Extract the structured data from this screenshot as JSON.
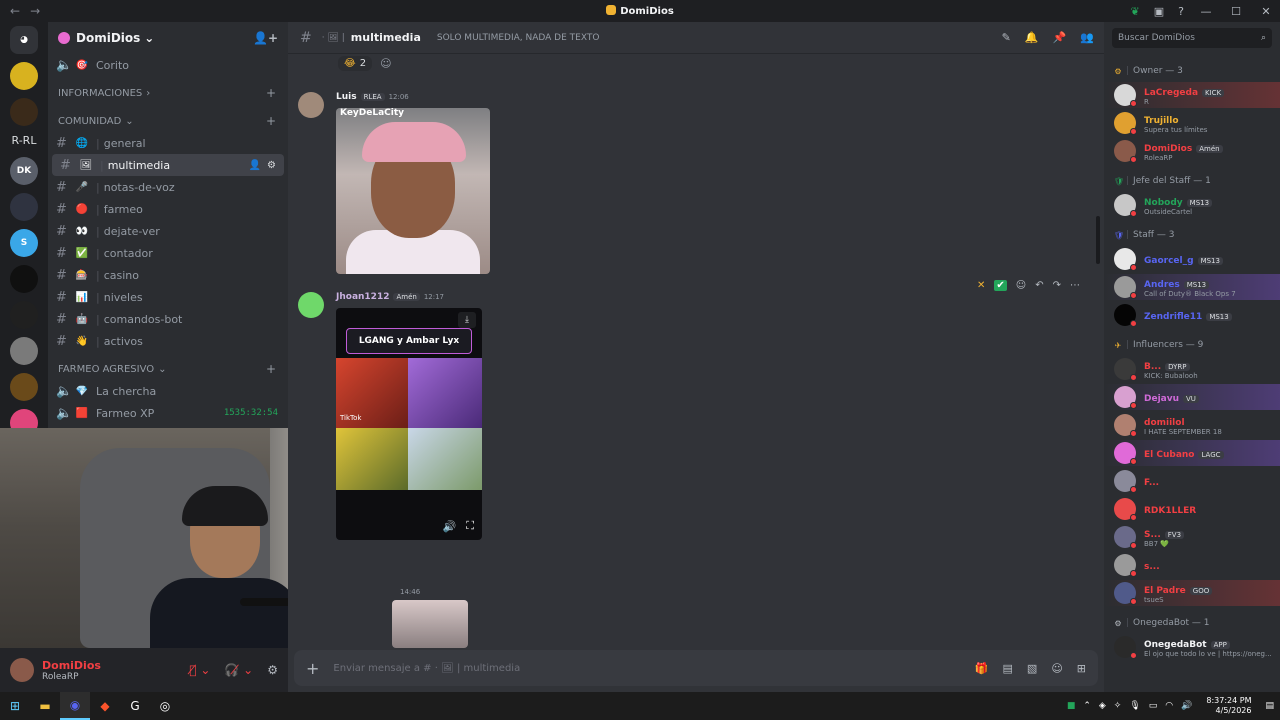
{
  "window": {
    "title": "DomiDios",
    "nav_back": "←",
    "nav_forward": "→",
    "minimize": "—",
    "maximize": "☐",
    "close": "✕"
  },
  "servers": [
    {
      "name": "home",
      "label": "",
      "color": "#313338"
    },
    {
      "name": "server-yellow",
      "label": "",
      "color": "#d8b21f"
    },
    {
      "name": "server-dark",
      "label": "",
      "color": "#3a2a1a"
    },
    {
      "name": "server-rrl",
      "label": "R-RL",
      "color": "#1e1f22"
    },
    {
      "name": "server-dk",
      "label": "DK",
      "color": "#5a5f6a"
    },
    {
      "name": "server-robot",
      "label": "",
      "color": "#2f3340"
    },
    {
      "name": "server-s",
      "label": "S",
      "color": "#3aa7e8"
    },
    {
      "name": "server-x",
      "label": "",
      "color": "#101010"
    },
    {
      "name": "server-dark2",
      "label": "",
      "color": "#202020"
    },
    {
      "name": "server-grey",
      "label": "",
      "color": "#7a7a7a"
    },
    {
      "name": "server-gold",
      "label": "",
      "color": "#6a4a1a"
    },
    {
      "name": "server-pink",
      "label": "",
      "color": "#e0457b"
    }
  ],
  "guild": {
    "name": "DomiDios",
    "chevron": "⌄",
    "invite_icon": "👤+"
  },
  "channels": {
    "top_item": {
      "emoji": "🎯",
      "label": "Corito"
    },
    "categories": [
      {
        "key": "info",
        "label": "INFORMACIONES"
      },
      {
        "key": "comunidad",
        "label": "COMUNIDAD"
      },
      {
        "key": "farmeo",
        "label": "FARMEO AGRESIVO"
      }
    ],
    "comunidad": [
      {
        "emoji": "🌐",
        "label": "general",
        "active": false
      },
      {
        "emoji": "🖼",
        "label": "multimedia",
        "active": true
      },
      {
        "emoji": "🎤",
        "label": "notas-de-voz",
        "active": false
      },
      {
        "emoji": "🔴",
        "label": "farmeo",
        "active": false
      },
      {
        "emoji": "👀",
        "label": "dejate-ver",
        "active": false
      },
      {
        "emoji": "✅",
        "label": "contador",
        "active": false
      },
      {
        "emoji": "🎰",
        "label": "casino",
        "active": false
      },
      {
        "emoji": "📊",
        "label": "niveles",
        "active": false
      },
      {
        "emoji": "🤖",
        "label": "comandos-bot",
        "active": false
      },
      {
        "emoji": "👋",
        "label": "activos",
        "active": false
      }
    ],
    "voice": [
      {
        "emoji": "💎",
        "label": "La chercha",
        "timer": ""
      },
      {
        "emoji": "🟥",
        "label": "Farmeo XP",
        "timer": "1535:32:54"
      }
    ]
  },
  "user": {
    "name": "DomiDios",
    "status": "RoleaRP"
  },
  "header": {
    "channel": "multimedia",
    "topic": "SOLO MULTIMEDIA, NADA DE TEXTO"
  },
  "reaction": {
    "emoji": "😂",
    "count": "2"
  },
  "messages": [
    {
      "author": "Luis",
      "tag": "RLEA",
      "time": "12:06",
      "color": "#f2f3f5",
      "avatar": "#a08a7a",
      "caption": "KeyDeLaCity"
    },
    {
      "author": "Jhoan1212",
      "tag": "Amén",
      "time": "12:17",
      "color": "#c9b1e0",
      "avatar": "#6fd86a",
      "banner": "LGANG y Ambar Lyx",
      "watermark": "TikTok"
    },
    {
      "time": "14:46"
    }
  ],
  "composer": {
    "placeholder": "Enviar mensaje a # · 🖼 | multimedia"
  },
  "members": {
    "search_placeholder": "Buscar DomiDios",
    "groups": [
      {
        "title": "Owner — 3",
        "icon": "⚙",
        "icon_color": "#f0b232",
        "items": [
          {
            "name": "LaCregeda",
            "sub": "R",
            "tag": "KICK",
            "color": "#f23f43",
            "avatar": "#d8d8d8",
            "hl": "hl2"
          },
          {
            "name": "Trujillo",
            "sub": "Supera tus límites",
            "tag": "",
            "color": "#f0b232",
            "avatar": "#e0a030",
            "hl": ""
          },
          {
            "name": "DomiDios",
            "sub": "RoleaRP",
            "tag": "Amén",
            "color": "#f23f43",
            "avatar": "#8a5a4a",
            "hl": ""
          }
        ]
      },
      {
        "title": "Jefe del Staff — 1",
        "icon": "🛡",
        "icon_color": "#23a55a",
        "items": [
          {
            "name": "Nobody",
            "sub": "OutsideCartel",
            "tag": "MS13",
            "color": "#23a55a",
            "avatar": "#c7c7c7",
            "hl": ""
          }
        ]
      },
      {
        "title": "Staff — 3",
        "icon": "🛡",
        "icon_color": "#5865f2",
        "items": [
          {
            "name": "Gaorcel_g",
            "sub": "",
            "tag": "MS13",
            "color": "#5865f2",
            "avatar": "#e8e8e8",
            "hl": ""
          },
          {
            "name": "Andres",
            "sub": "Call of Duty® Black Ops 7",
            "tag": "MS13",
            "color": "#5865f2",
            "avatar": "#9a9a9a",
            "hl": "hl"
          },
          {
            "name": "Zendrifle11",
            "sub": "",
            "tag": "MS13",
            "color": "#5865f2",
            "avatar": "#050505",
            "hl": ""
          }
        ]
      },
      {
        "title": "Influencers — 9",
        "icon": "✈",
        "icon_color": "#f0b232",
        "items": [
          {
            "name": "B...",
            "sub": "KICK: Bubalooh",
            "tag": "DYRP",
            "color": "#f23f43",
            "avatar": "#3a3a3a",
            "hl": ""
          },
          {
            "name": "Dejavu",
            "sub": "",
            "tag": "VU",
            "color": "#d06ad8",
            "avatar": "#d8a0d0",
            "hl": "hl"
          },
          {
            "name": "domiilol",
            "sub": "I HATE SEPTEMBER 18",
            "tag": "",
            "color": "#f23f43",
            "avatar": "#b08070",
            "hl": ""
          },
          {
            "name": "El Cubano",
            "sub": "",
            "tag": "LAGC",
            "color": "#f23f43",
            "avatar": "#e06ad8",
            "hl": "hl"
          },
          {
            "name": "F...",
            "sub": "",
            "tag": "",
            "color": "#f23f43",
            "avatar": "#8a8a9a",
            "hl": ""
          },
          {
            "name": "RDK1LLER",
            "sub": "",
            "tag": "",
            "color": "#f23f43",
            "avatar": "#e84a4a",
            "hl": ""
          },
          {
            "name": "S...",
            "sub": "BB7 💚",
            "tag": "FV3",
            "color": "#f23f43",
            "avatar": "#6a6a8a",
            "hl": ""
          },
          {
            "name": "s...",
            "sub": "",
            "tag": "",
            "color": "#f23f43",
            "avatar": "#9a9a9a",
            "hl": ""
          },
          {
            "name": "El Padre",
            "sub": "tsueS",
            "tag": "GOO",
            "color": "#f23f43",
            "avatar": "#505a8a",
            "hl": "hl2"
          }
        ]
      },
      {
        "title": "OnegedaBot — 1",
        "icon": "⚙",
        "icon_color": "#b5bac1",
        "items": [
          {
            "name": "OnegedaBot",
            "sub": "El ojo que todo lo ve | https://oneg...",
            "tag": "APP",
            "color": "#f2f3f5",
            "avatar": "#2a2a2a",
            "hl": ""
          }
        ]
      }
    ]
  },
  "taskbar": {
    "time": "8:37:24 PM",
    "date": "4/5/2026"
  }
}
